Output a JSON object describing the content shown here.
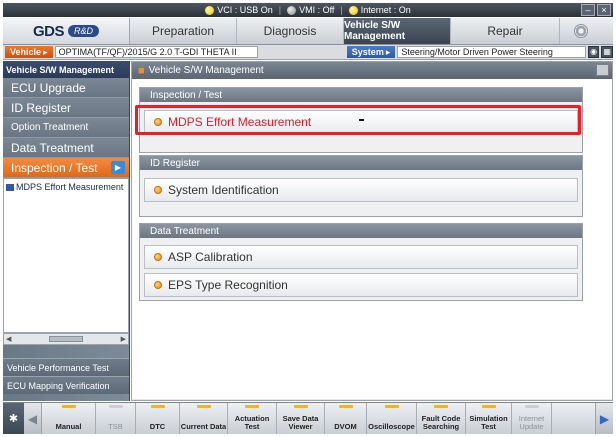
{
  "status_bar": {
    "items": [
      {
        "label": "VCI : USB On",
        "indicator": "yellow"
      },
      {
        "label": "VMI : Off",
        "indicator": "grey"
      },
      {
        "label": "Internet : On",
        "indicator": "yellow"
      }
    ],
    "window_buttons": [
      "–",
      "×"
    ]
  },
  "header": {
    "logo_text": "GDS",
    "logo_badge": "R&D",
    "tabs": [
      "Preparation",
      "Diagnosis",
      "Vehicle S/W Management",
      "Repair"
    ],
    "active_tab": "Vehicle S/W Management"
  },
  "info_bar": {
    "vehicle_label": "Vehicle",
    "vehicle_value": "OPTIMA(TF/QF)/2015/G 2.0 T-GDI THETA II",
    "system_label": "System",
    "system_value": "Steering/Motor Driven Power Steering"
  },
  "sidebar": {
    "title": "Vehicle S/W Management",
    "items": [
      "ECU Upgrade",
      "ID Register",
      "Option Treatment",
      "Data Treatment",
      "Inspection / Test"
    ],
    "active_item": "Inspection / Test",
    "tree_item": "MDPS Effort Measurement",
    "bottom_items": [
      "Vehicle Performance Test",
      "ECU Mapping Verification"
    ]
  },
  "main": {
    "title": "Vehicle S/W Management",
    "groups": [
      {
        "header": "Inspection / Test",
        "items": [
          "MDPS Effort Measurement"
        ]
      },
      {
        "header": "ID Register",
        "items": [
          "System Identification"
        ]
      },
      {
        "header": "Data Treatment",
        "items": [
          "ASP Calibration",
          "EPS Type Recognition"
        ]
      }
    ],
    "highlighted_item": "MDPS Effort Measurement"
  },
  "toolbar": {
    "side_label": "설정",
    "buttons": [
      {
        "label": "Manual",
        "enabled": true
      },
      {
        "label": "TSB",
        "enabled": false
      },
      {
        "label": "DTC",
        "enabled": true
      },
      {
        "label": "Current Data",
        "enabled": true
      },
      {
        "label": "Actuation Test",
        "enabled": true
      },
      {
        "label": "Save Data Viewer",
        "enabled": true
      },
      {
        "label": "DVOM",
        "enabled": true
      },
      {
        "label": "Oscilloscope",
        "enabled": true
      },
      {
        "label": "Fault Code Searching",
        "enabled": true
      },
      {
        "label": "Simulation Test",
        "enabled": true
      },
      {
        "label": "Internet Update",
        "enabled": false
      }
    ]
  },
  "colors": {
    "accent_orange": "#f08a2a",
    "highlight_red": "#ee1c24",
    "active_tab_bg": "#3a4450"
  }
}
